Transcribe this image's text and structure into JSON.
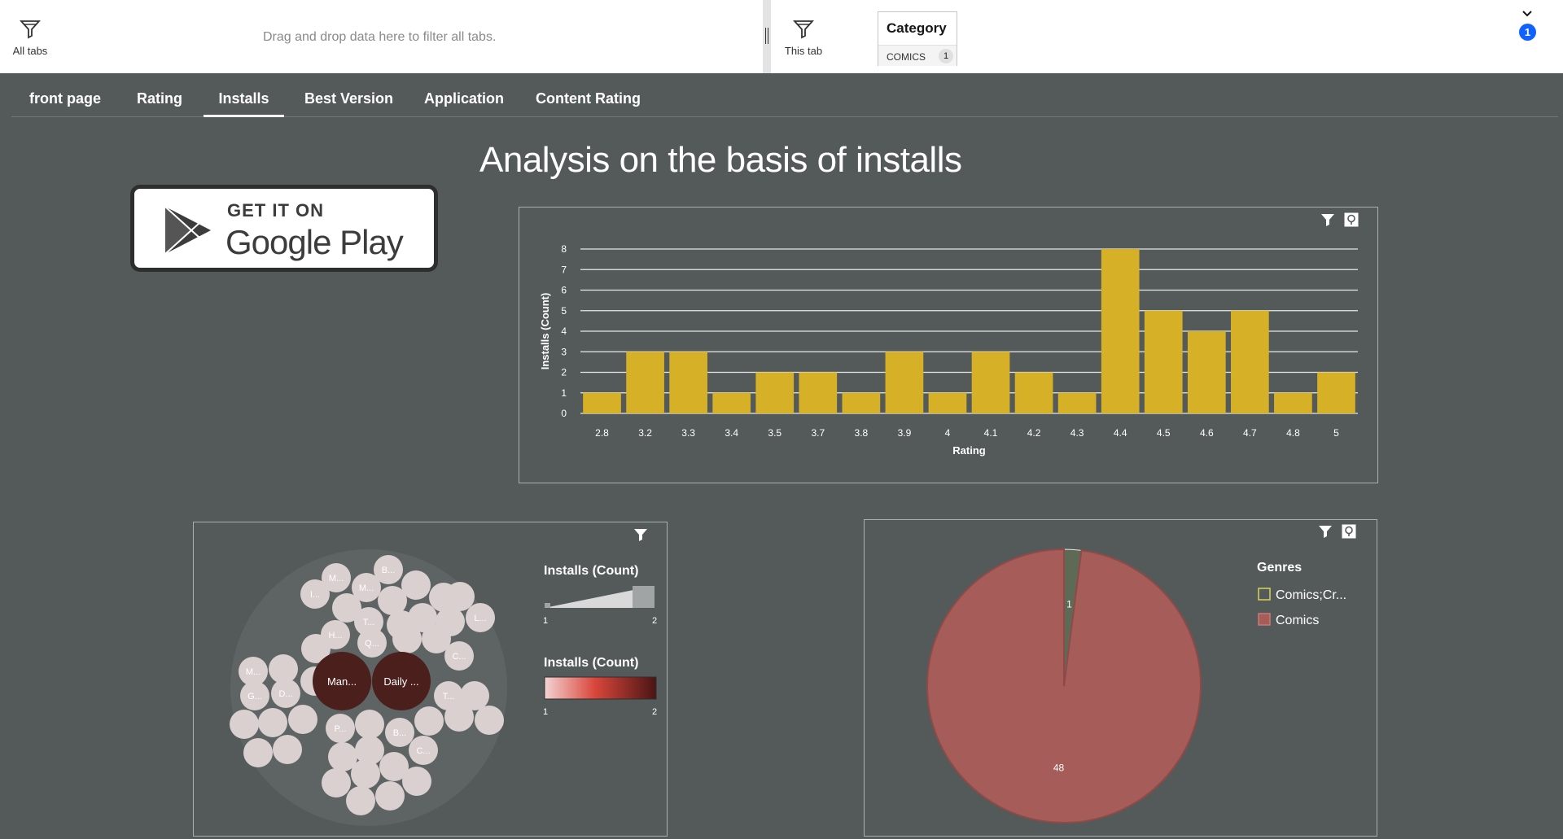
{
  "filter_bar": {
    "all_tabs_label": "All tabs",
    "drop_hint": "Drag and drop data here to filter all tabs.",
    "this_tab_label": "This tab",
    "category_filter": {
      "title": "Category",
      "value": "COMICS",
      "count": "1"
    },
    "notification_count": "1"
  },
  "tabs": [
    {
      "label": "front page",
      "active": false
    },
    {
      "label": "Rating",
      "active": false
    },
    {
      "label": "Installs",
      "active": true
    },
    {
      "label": "Best Version",
      "active": false
    },
    {
      "label": "Application",
      "active": false
    },
    {
      "label": "Content Rating",
      "active": false
    }
  ],
  "page_title": "Analysis on the basis of installs",
  "google_play_badge": {
    "top": "GET IT ON",
    "bottom": "Google Play"
  },
  "colors": {
    "background": "#545a5a",
    "bar": "#d6b027",
    "pie_comics": "#a65c59",
    "pie_comics_cr": "#5e6a55",
    "pack_bubble": "#d9d0cf",
    "pack_dark": "#4a1f1c",
    "accent": "#0f62fe"
  },
  "chart_data": [
    {
      "type": "bar",
      "xlabel": "Rating",
      "ylabel": "Installs (Count)",
      "ylim": [
        0,
        8
      ],
      "yticks": [
        0,
        1,
        2,
        3,
        4,
        5,
        6,
        7,
        8
      ],
      "categories": [
        "2.8",
        "3.2",
        "3.3",
        "3.4",
        "3.5",
        "3.7",
        "3.8",
        "3.9",
        "4",
        "4.1",
        "4.2",
        "4.3",
        "4.4",
        "4.5",
        "4.6",
        "4.7",
        "4.8",
        "5"
      ],
      "values": [
        1,
        3,
        3,
        1,
        2,
        2,
        1,
        3,
        1,
        3,
        2,
        1,
        8,
        5,
        4,
        5,
        1,
        2
      ],
      "grid": true
    },
    {
      "type": "packed-bubble",
      "legend": [
        {
          "title": "Installs (Count)",
          "kind": "size",
          "min": "1",
          "max": "2"
        },
        {
          "title": "Installs (Count)",
          "kind": "color",
          "min": "1",
          "max": "2"
        }
      ],
      "large_labels": [
        "Man...",
        "Daily ..."
      ],
      "small_labels": [
        "M...",
        "B...",
        "I...",
        "M...",
        "T...",
        "L...",
        "C...",
        "H...",
        "Q...",
        "M...",
        "G...",
        "D...",
        "T...",
        "P...",
        "B...",
        "C..."
      ]
    },
    {
      "type": "pie",
      "legend_title": "Genres",
      "legend_position": "right",
      "slices": [
        {
          "label": "Comics;Cr...",
          "value": 1
        },
        {
          "label": "Comics",
          "value": 48
        }
      ]
    }
  ]
}
